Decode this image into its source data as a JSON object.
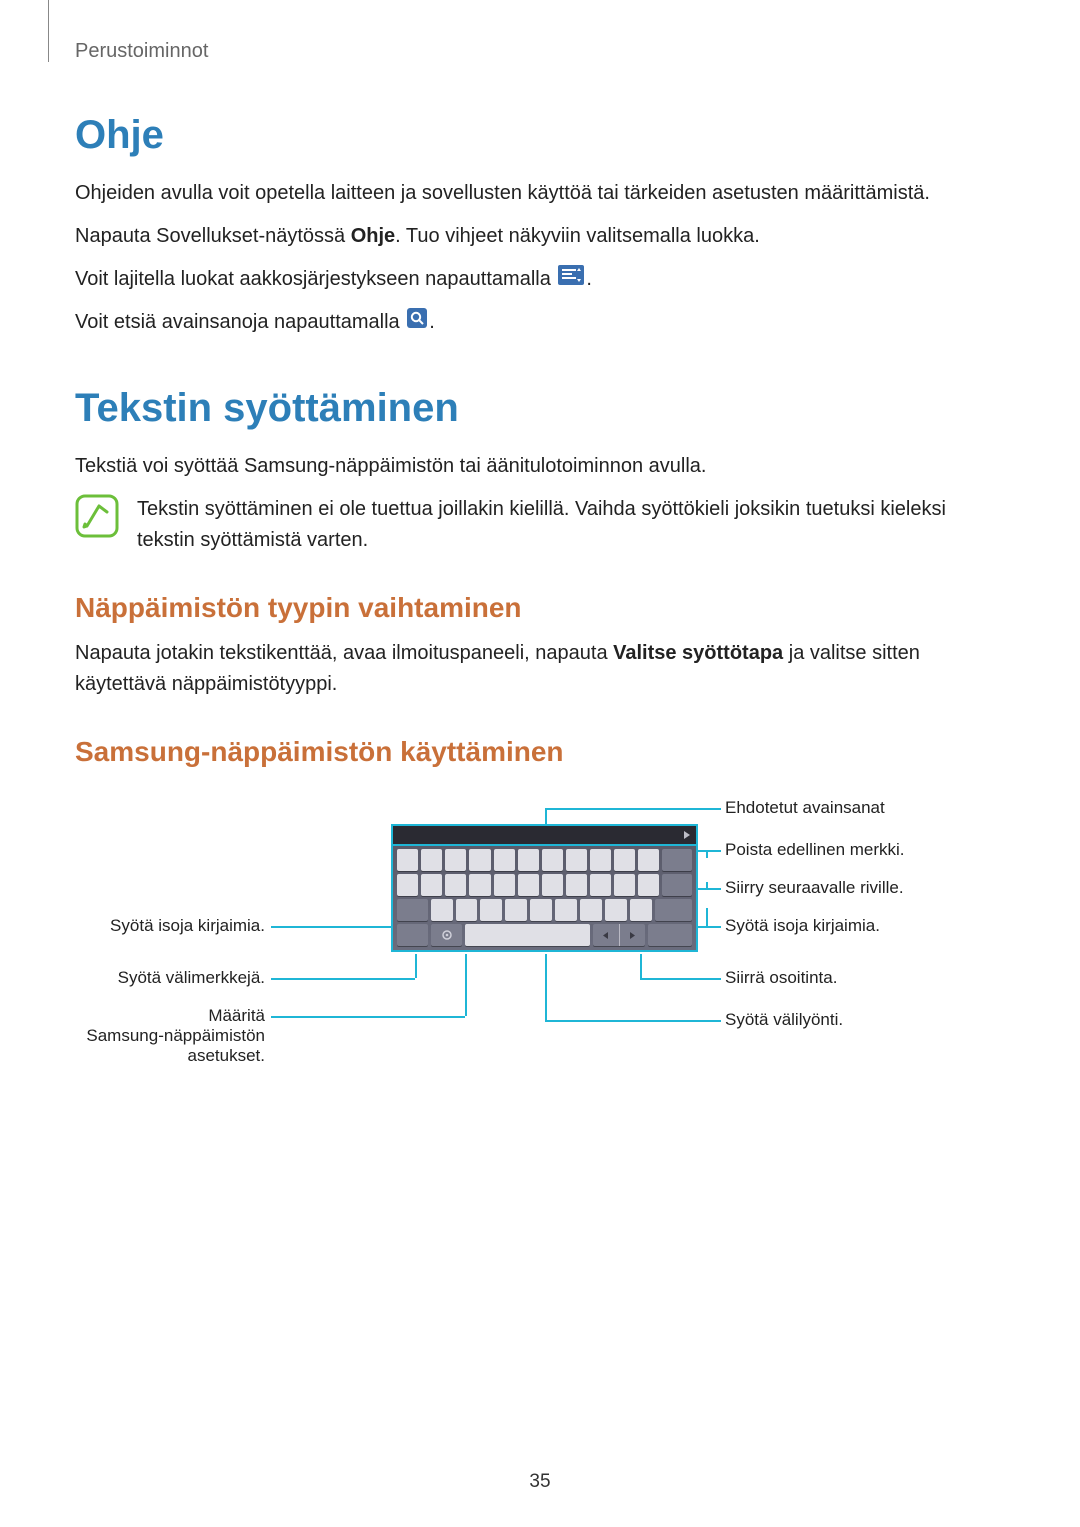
{
  "header": {
    "section": "Perustoiminnot"
  },
  "ohje": {
    "title": "Ohje",
    "p1": "Ohjeiden avulla voit opetella laitteen ja sovellusten käyttöä tai tärkeiden asetusten määrittämistä.",
    "p2_before": "Napauta Sovellukset-näytössä ",
    "p2_bold": "Ohje",
    "p2_after": ". Tuo vihjeet näkyviin valitsemalla luokka.",
    "p3_before": "Voit lajitella luokat aakkosjärjestykseen napauttamalla ",
    "p3_after": ".",
    "p4_before": "Voit etsiä avainsanoja napauttamalla ",
    "p4_after": "."
  },
  "tekstin": {
    "title": "Tekstin syöttäminen",
    "p1": "Tekstiä voi syöttää Samsung-näppäimistön tai äänitulotoiminnon avulla.",
    "note": "Tekstin syöttäminen ei ole tuettua joillakin kielillä. Vaihda syöttökieli joksikin tuetuksi kieleksi tekstin syöttämistä varten."
  },
  "sub1": {
    "title": "Näppäimistön tyypin vaihtaminen",
    "p_before": "Napauta jotakin tekstikenttää, avaa ilmoituspaneeli, napauta ",
    "p_bold": "Valitse syöttötapa",
    "p_after": " ja valitse sitten käytettävä näppäimistötyyppi."
  },
  "sub2": {
    "title": "Samsung-näppäimistön käyttäminen"
  },
  "callouts": {
    "right": {
      "r1": "Ehdotetut avainsanat",
      "r2": "Poista edellinen merkki.",
      "r3": "Siirry seuraavalle riville.",
      "r4": "Syötä isoja kirjaimia.",
      "r5": "Siirrä osoitinta.",
      "r6": "Syötä välilyönti."
    },
    "left": {
      "l1": "Syötä isoja kirjaimia.",
      "l2": "Syötä välimerkkejä.",
      "l3a": "Määritä",
      "l3b": "Samsung-näppäimistön",
      "l3c": "asetukset."
    }
  },
  "pagenum": "35"
}
